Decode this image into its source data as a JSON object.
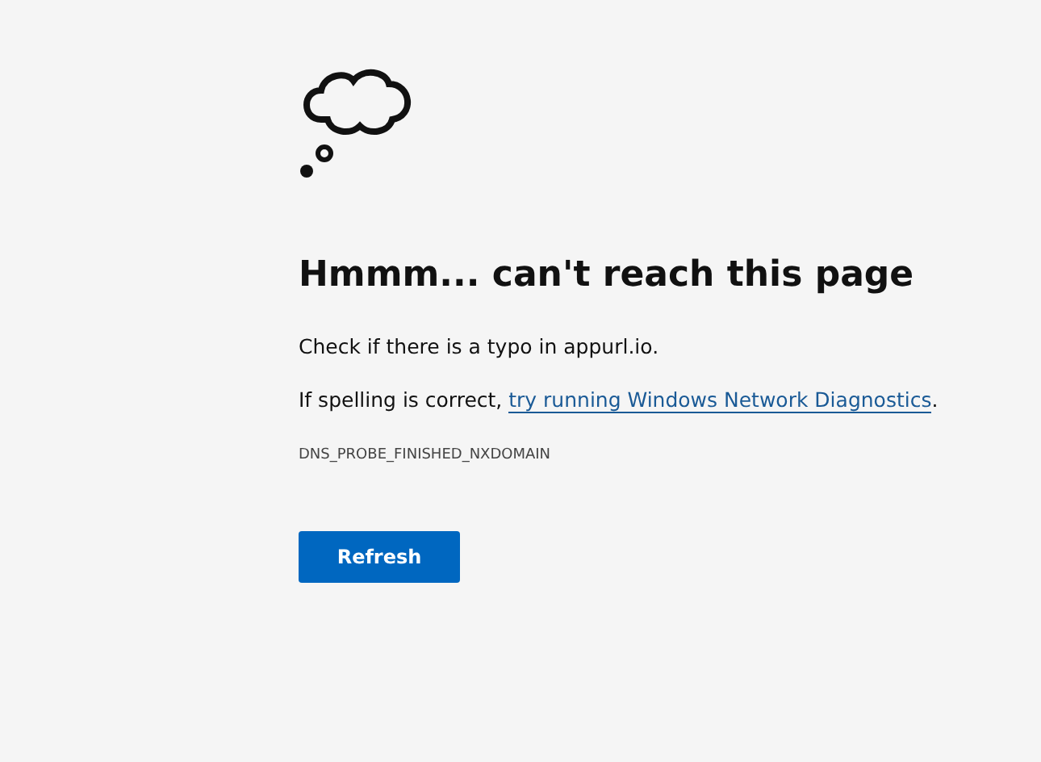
{
  "heading": "Hmmm... can't reach this page",
  "hint": "Check if there is a typo in appurl.io.",
  "suggestion": {
    "prefix": "If spelling is correct, ",
    "link": "try running Windows Network Diagnostics",
    "suffix": "."
  },
  "error_code": "DNS_PROBE_FINISHED_NXDOMAIN",
  "buttons": [
    "Refresh"
  ]
}
